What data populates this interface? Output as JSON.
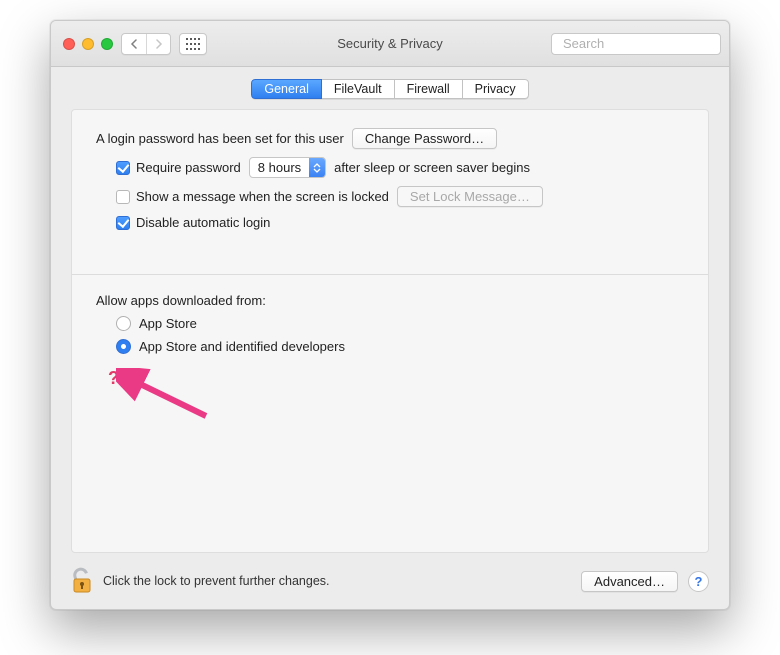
{
  "window": {
    "title": "Security & Privacy"
  },
  "search": {
    "placeholder": "Search"
  },
  "tabs": [
    {
      "label": "General",
      "selected": true
    },
    {
      "label": "FileVault",
      "selected": false
    },
    {
      "label": "Firewall",
      "selected": false
    },
    {
      "label": "Privacy",
      "selected": false
    }
  ],
  "general": {
    "password_set_text": "A login password has been set for this user",
    "change_password_btn": "Change Password…",
    "require_password": {
      "checked": true,
      "label_before": "Require password",
      "delay_value": "8 hours",
      "label_after": "after sleep or screen saver begins"
    },
    "show_message": {
      "checked": false,
      "label": "Show a message when the screen is locked",
      "set_btn": "Set Lock Message…",
      "set_btn_disabled": true
    },
    "disable_auto_login": {
      "checked": true,
      "label": "Disable automatic login"
    },
    "gatekeeper": {
      "header": "Allow apps downloaded from:",
      "options": [
        {
          "label": "App Store",
          "selected": false
        },
        {
          "label": "App Store and identified developers",
          "selected": true
        }
      ]
    },
    "annotation_mark": "?"
  },
  "footer": {
    "lock_text": "Click the lock to prevent further changes.",
    "advanced_btn": "Advanced…",
    "help_btn": "?"
  }
}
